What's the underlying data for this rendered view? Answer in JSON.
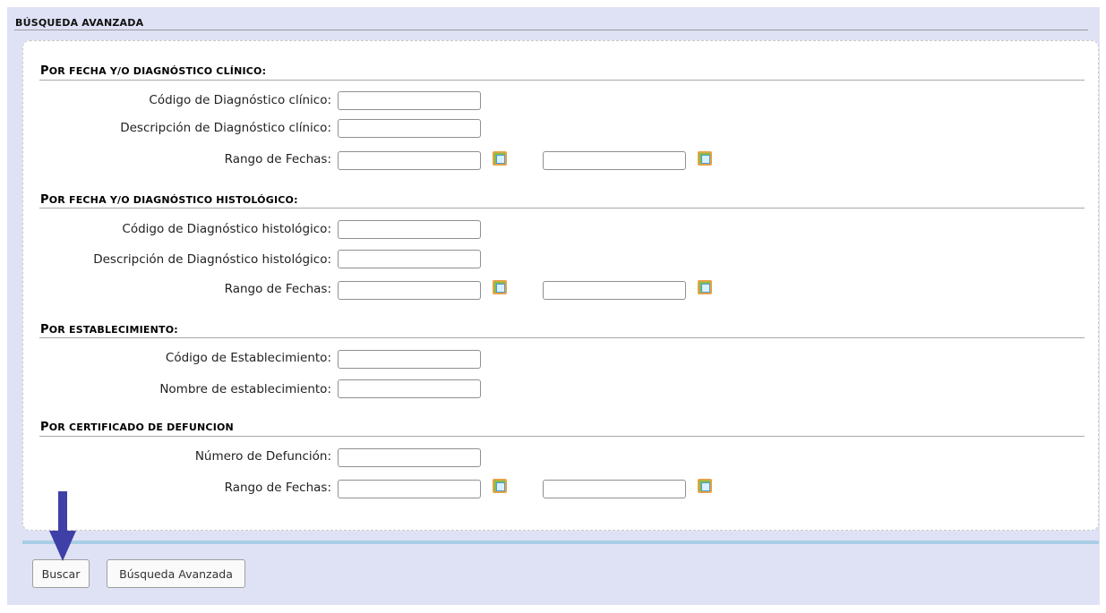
{
  "header": {
    "title": "BÚSQUEDA AVANZADA"
  },
  "sections": [
    {
      "title_first": "P",
      "title_rest": "OR FECHA Y/O DIAGNÓSTICO CLÍNICO:",
      "fields": [
        {
          "label": "Código de Diagnóstico clínico:",
          "value": ""
        },
        {
          "label": "Descripción de Diagnóstico clínico:",
          "value": ""
        }
      ],
      "range_label": "Rango de Fechas:"
    },
    {
      "title_first": "P",
      "title_rest": "OR FECHA Y/O DIAGNÓSTICO HISTOLÓGICO:",
      "fields": [
        {
          "label": "Código de Diagnóstico histológico:",
          "value": ""
        },
        {
          "label": "Descripción de Diagnóstico histológico:",
          "value": ""
        }
      ],
      "range_label": "Rango de Fechas:"
    },
    {
      "title_first": "P",
      "title_rest": "OR ESTABLECIMIENTO:",
      "fields": [
        {
          "label": "Código de Establecimiento:",
          "value": ""
        },
        {
          "label": "Nombre de establecimiento:",
          "value": ""
        }
      ]
    },
    {
      "title_first": "P",
      "title_rest": "OR CERTIFICADO DE DEFUNCION",
      "fields": [
        {
          "label": "Número de Defunción:",
          "value": ""
        }
      ],
      "range_label": "Rango de Fechas:"
    }
  ],
  "icons": {
    "calendar": "calendar-icon",
    "pointer": "down-arrow-icon"
  },
  "buttons": {
    "search": "Buscar",
    "advanced": "Búsqueda Avanzada"
  },
  "colors": {
    "background": "#dfe2f5",
    "accent_bar": "#a9cde7",
    "arrow": "#3f3fa8"
  }
}
